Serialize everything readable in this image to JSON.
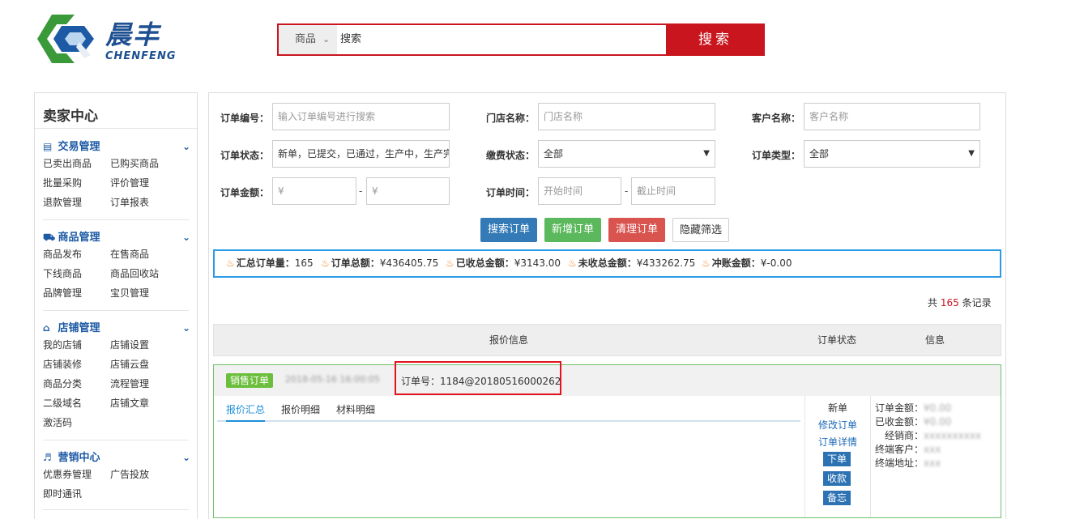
{
  "header": {
    "logo_cn": "晨丰",
    "logo_en": "CHENFENG",
    "search_category": "商品",
    "search_placeholder": "搜索",
    "search_button": "搜索",
    "accent_color": "#c9151e"
  },
  "sidebar": {
    "title": "卖家中心",
    "groups": [
      {
        "icon": "list-icon",
        "title": "交易管理",
        "items": [
          "已卖出商品",
          "已购买商品",
          "批量采购",
          "评价管理",
          "退款管理",
          "订单报表"
        ]
      },
      {
        "icon": "truck-icon",
        "title": "商品管理",
        "items": [
          "商品发布",
          "在售商品",
          "下线商品",
          "商品回收站",
          "品牌管理",
          "宝贝管理"
        ]
      },
      {
        "icon": "home-icon",
        "title": "店铺管理",
        "items": [
          "我的店铺",
          "店铺设置",
          "店铺装修",
          "店铺云盘",
          "商品分类",
          "流程管理",
          "二级域名",
          "店铺文章",
          "激活码"
        ]
      },
      {
        "icon": "speaker-icon",
        "title": "营销中心",
        "items": [
          "优惠券管理",
          "广告投放",
          "即时通讯"
        ]
      }
    ]
  },
  "filters": {
    "order_no_label": "订单编号：",
    "order_no_placeholder": "输入订单编号进行搜索",
    "store_label": "门店名称：",
    "store_placeholder": "门店名称",
    "customer_label": "客户名称：",
    "customer_placeholder": "客户名称",
    "status_label": "订单状态：",
    "status_value": "新单，已提交，已通过，生产中，生产完",
    "pay_label": "缴费状态：",
    "pay_value": "全部",
    "type_label": "订单类型：",
    "type_value": "全部",
    "amount_label": "订单金额：",
    "amount_min_placeholder": "¥",
    "amount_max_placeholder": "¥",
    "time_label": "订单时间：",
    "time_start_placeholder": "开始时间",
    "time_end_placeholder": "截止时间",
    "dash": "-"
  },
  "actions": {
    "search": "搜索订单",
    "add": "新增订单",
    "clear": "清理订单",
    "hide": "隐藏筛选"
  },
  "summary": [
    {
      "label": "汇总订单量：",
      "value": "165"
    },
    {
      "label": "订单总额：",
      "value": "¥436405.75"
    },
    {
      "label": "已收总金额：",
      "value": "¥3143.00"
    },
    {
      "label": "未收总金额：",
      "value": "¥433262.75"
    },
    {
      "label": "冲账金额：",
      "value": "¥-0.00"
    }
  ],
  "records": {
    "prefix": "共",
    "count": "165",
    "suffix": "条记录"
  },
  "table_headers": {
    "quote": "报价信息",
    "status": "订单状态",
    "info": "信息"
  },
  "order": {
    "tag": "销售订单",
    "date_blurred": "2018-05-16 16:00:05",
    "order_no": "订单号：1184@20180516000262",
    "tabs": [
      "报价汇总",
      "报价明细",
      "材料明细"
    ],
    "status": "新单",
    "links": [
      "修改订单",
      "订单详情"
    ],
    "buttons": [
      "下单",
      "收款",
      "备忘"
    ],
    "info": [
      {
        "label": "订单金额：",
        "value": "¥0.00"
      },
      {
        "label": "已收金额：",
        "value": "¥0.00"
      },
      {
        "label": "经销商：",
        "value": "xxxxxxxxxx"
      },
      {
        "label": "终端客户：",
        "value": "xxx"
      },
      {
        "label": "终端地址：",
        "value": "xxx"
      }
    ]
  }
}
